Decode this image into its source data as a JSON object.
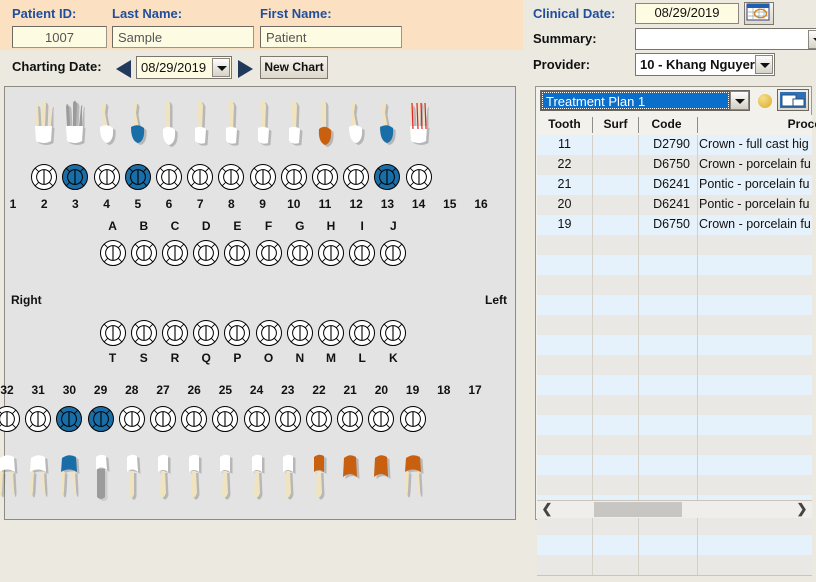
{
  "patient": {
    "id_label": "Patient ID:",
    "id_value": "1007",
    "last_name_label": "Last Name:",
    "last_name_value": "Sample",
    "first_name_label": "First Name:",
    "first_name_value": "Patient"
  },
  "charting": {
    "label": "Charting Date:",
    "date_value": "08/29/2019",
    "prev_icon": "left-arrow-icon",
    "next_icon": "right-arrow-icon",
    "new_chart_label": "New Chart"
  },
  "clinical": {
    "date_label": "Clinical Date:",
    "date_value": "08/29/2019",
    "calendar_icon": "calendar-icon",
    "summary_label": "Summary:",
    "summary_value": "",
    "provider_label": "Provider:",
    "provider_value": "10 - Khang Nguyer"
  },
  "treatment": {
    "plan_value": "Treatment Plan 1",
    "status_icon": "gold-circle-icon",
    "window_icon": "window-icon",
    "columns": [
      "Tooth",
      "Surf",
      "Code",
      "Procedure"
    ],
    "rows": [
      {
        "tooth": "11",
        "surf": "",
        "code": "D2790",
        "procedure": "Crown - full cast hig"
      },
      {
        "tooth": "22",
        "surf": "",
        "code": "D6750",
        "procedure": "Crown - porcelain fu"
      },
      {
        "tooth": "21",
        "surf": "",
        "code": "D6241",
        "procedure": "Pontic - porcelain fu"
      },
      {
        "tooth": "20",
        "surf": "",
        "code": "D6241",
        "procedure": "Pontic - porcelain fu"
      },
      {
        "tooth": "19",
        "surf": "",
        "code": "D6750",
        "procedure": "Crown - porcelain fu"
      }
    ],
    "empty_row_count": 17,
    "scroll_left_icon": "chevron-left-icon",
    "scroll_right_icon": "chevron-right-icon"
  },
  "chart": {
    "right_label": "Right",
    "left_label": "Left",
    "upper_numbers": [
      "1",
      "2",
      "3",
      "4",
      "5",
      "6",
      "7",
      "8",
      "9",
      "10",
      "11",
      "12",
      "13",
      "14",
      "15",
      "16"
    ],
    "lower_numbers": [
      "32",
      "31",
      "30",
      "29",
      "28",
      "27",
      "26",
      "25",
      "24",
      "23",
      "22",
      "21",
      "20",
      "19",
      "18",
      "17"
    ],
    "upper_primary": [
      "A",
      "B",
      "C",
      "D",
      "E",
      "F",
      "G",
      "H",
      "I",
      "J"
    ],
    "lower_primary": [
      "T",
      "S",
      "R",
      "Q",
      "P",
      "O",
      "N",
      "M",
      "L",
      "K"
    ],
    "upper_selected": [
      "3",
      "5",
      "13"
    ],
    "lower_selected": [
      "30",
      "29"
    ],
    "upper_tooth_graphics": [
      {
        "num": "1",
        "shape": "molar",
        "crown": "#ffffff",
        "root": "#efe3c0"
      },
      {
        "num": "2",
        "shape": "molar-metal",
        "crown": "#ffffff",
        "root": "#9b9b9b"
      },
      {
        "num": "3",
        "shape": "bicuspid",
        "crown": "#ffffff",
        "root": "#efe3c0"
      },
      {
        "num": "4",
        "shape": "bicuspid",
        "crown": "#1a6ea8",
        "root": "#efe3c0"
      },
      {
        "num": "5",
        "shape": "canine",
        "crown": "#ffffff",
        "root": "#efe3c0"
      },
      {
        "num": "6",
        "shape": "incisor",
        "crown": "#ffffff",
        "root": "#efe3c0"
      },
      {
        "num": "7",
        "shape": "incisor",
        "crown": "#ffffff",
        "root": "#efe3c0"
      },
      {
        "num": "8",
        "shape": "incisor",
        "crown": "#ffffff",
        "root": "#efe3c0"
      },
      {
        "num": "9",
        "shape": "incisor",
        "crown": "#ffffff",
        "root": "#efe3c0"
      },
      {
        "num": "10",
        "shape": "canine",
        "crown": "#c8600f",
        "root": "#efe3c0"
      },
      {
        "num": "11",
        "shape": "bicuspid",
        "crown": "#ffffff",
        "root": "#efe3c0"
      },
      {
        "num": "12",
        "shape": "bicuspid",
        "crown": "#1a6ea8",
        "root": "#efe3c0"
      },
      {
        "num": "13",
        "shape": "molar-rct",
        "crown": "#ffffff",
        "root": "#efe3c0"
      }
    ],
    "lower_tooth_graphics": [
      {
        "num": "32",
        "shape": "molar",
        "crown": "#ffffff",
        "root": "#efe3c0"
      },
      {
        "num": "31",
        "shape": "molar",
        "crown": "#ffffff",
        "root": "#efe3c0"
      },
      {
        "num": "30",
        "shape": "molar",
        "crown": "#1a6ea8",
        "root": "#efe3c0"
      },
      {
        "num": "29",
        "shape": "post",
        "crown": "#ffffff",
        "root": "#9b9b9b"
      },
      {
        "num": "28",
        "shape": "bicuspid",
        "crown": "#ffffff",
        "root": "#efe3c0"
      },
      {
        "num": "27",
        "shape": "incisor",
        "crown": "#ffffff",
        "root": "#efe3c0"
      },
      {
        "num": "26",
        "shape": "incisor",
        "crown": "#ffffff",
        "root": "#efe3c0"
      },
      {
        "num": "25",
        "shape": "incisor",
        "crown": "#ffffff",
        "root": "#efe3c0"
      },
      {
        "num": "24",
        "shape": "incisor",
        "crown": "#ffffff",
        "root": "#efe3c0"
      },
      {
        "num": "23",
        "shape": "incisor",
        "crown": "#ffffff",
        "root": "#efe3c0"
      },
      {
        "num": "22",
        "shape": "canine",
        "crown": "#c8600f",
        "root": "#efe3c0"
      },
      {
        "num": "21",
        "shape": "crown-only",
        "crown": "#c8600f",
        "root": "#c8600f"
      },
      {
        "num": "20",
        "shape": "crown-only",
        "crown": "#c8600f",
        "root": "#c8600f"
      },
      {
        "num": "19",
        "shape": "molar",
        "crown": "#c8600f",
        "root": "#efe3c0"
      }
    ],
    "colors": {
      "selected_blue": "#1a6ea8",
      "existing_orange": "#c8600f",
      "metal_gray": "#9b9b9b",
      "rct_red": "#e02020"
    }
  }
}
